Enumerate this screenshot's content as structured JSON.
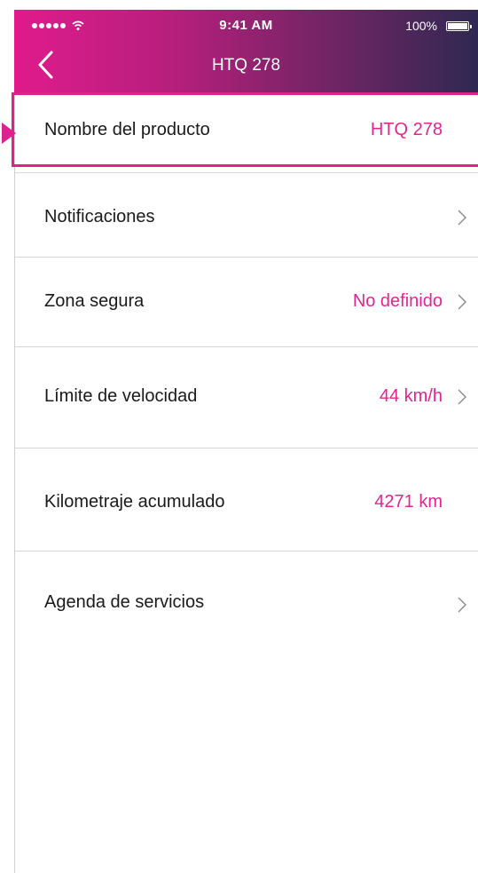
{
  "status_bar": {
    "time": "9:41 AM",
    "battery_percent": "100%",
    "signal_icon": "signal-dots-icon",
    "wifi_icon": "wifi-icon",
    "battery_icon": "battery-icon"
  },
  "nav": {
    "title": "HTQ 278",
    "back_icon": "chevron-left-icon"
  },
  "colors": {
    "accent": "#e5258f",
    "header_gradient_start": "#e01b8c",
    "header_gradient_end": "#2f2852",
    "text": "#1a1a1a",
    "divider": "#d6d6d6"
  },
  "settings": [
    {
      "label": "Nombre del producto",
      "value": "HTQ 278",
      "has_chevron": false,
      "selected": true
    },
    {
      "label": "Notificaciones",
      "value": "",
      "has_chevron": true,
      "selected": false
    },
    {
      "label": "Zona segura",
      "value": "No definido",
      "has_chevron": true,
      "selected": false
    },
    {
      "label": "Límite de velocidad",
      "value": "44 km/h",
      "has_chevron": true,
      "selected": false
    },
    {
      "label": "Kilometraje acumulado",
      "value": "4271 km",
      "has_chevron": false,
      "selected": false
    },
    {
      "label": "Agenda de servicios",
      "value": "",
      "has_chevron": true,
      "selected": false
    }
  ]
}
